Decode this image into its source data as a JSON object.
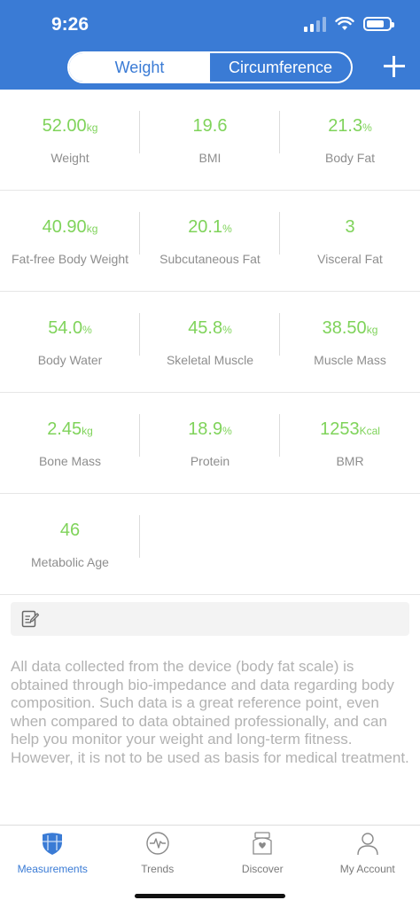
{
  "status_bar": {
    "time": "9:26"
  },
  "segments": [
    {
      "label": "Weight",
      "active": true
    },
    {
      "label": "Circumference",
      "active": false
    }
  ],
  "metrics": [
    {
      "value": "52.00",
      "unit": "kg",
      "label": "Weight"
    },
    {
      "value": "19.6",
      "unit": "",
      "label": "BMI"
    },
    {
      "value": "21.3",
      "unit": "%",
      "label": "Body Fat"
    },
    {
      "value": "40.90",
      "unit": "kg",
      "label": "Fat-free Body Weight"
    },
    {
      "value": "20.1",
      "unit": "%",
      "label": "Subcutaneous Fat"
    },
    {
      "value": "3",
      "unit": "",
      "label": "Visceral Fat"
    },
    {
      "value": "54.0",
      "unit": "%",
      "label": "Body Water"
    },
    {
      "value": "45.8",
      "unit": "%",
      "label": "Skeletal Muscle"
    },
    {
      "value": "38.50",
      "unit": "kg",
      "label": "Muscle Mass"
    },
    {
      "value": "2.45",
      "unit": "kg",
      "label": "Bone Mass"
    },
    {
      "value": "18.9",
      "unit": "%",
      "label": "Protein"
    },
    {
      "value": "1253",
      "unit": "Kcal",
      "label": "BMR"
    },
    {
      "value": "46",
      "unit": "",
      "label": "Metabolic Age"
    }
  ],
  "disclaimer": "All data collected from the device (body fat scale) is obtained through bio-impedance and data regarding body composition. Such data is a great reference point, even when compared to data obtained professionally, and can help you monitor your weight and long-term fitness. However, it is not to be used as basis for medical treatment.",
  "tabs": [
    {
      "label": "Measurements",
      "icon": "shield-icon",
      "active": true
    },
    {
      "label": "Trends",
      "icon": "heartbeat-icon",
      "active": false
    },
    {
      "label": "Discover",
      "icon": "discover-icon",
      "active": false
    },
    {
      "label": "My Account",
      "icon": "person-icon",
      "active": false
    }
  ],
  "colors": {
    "brand_blue": "#3a7bd5",
    "value_green": "#7fd35a",
    "label_gray": "#8e8e8e"
  }
}
